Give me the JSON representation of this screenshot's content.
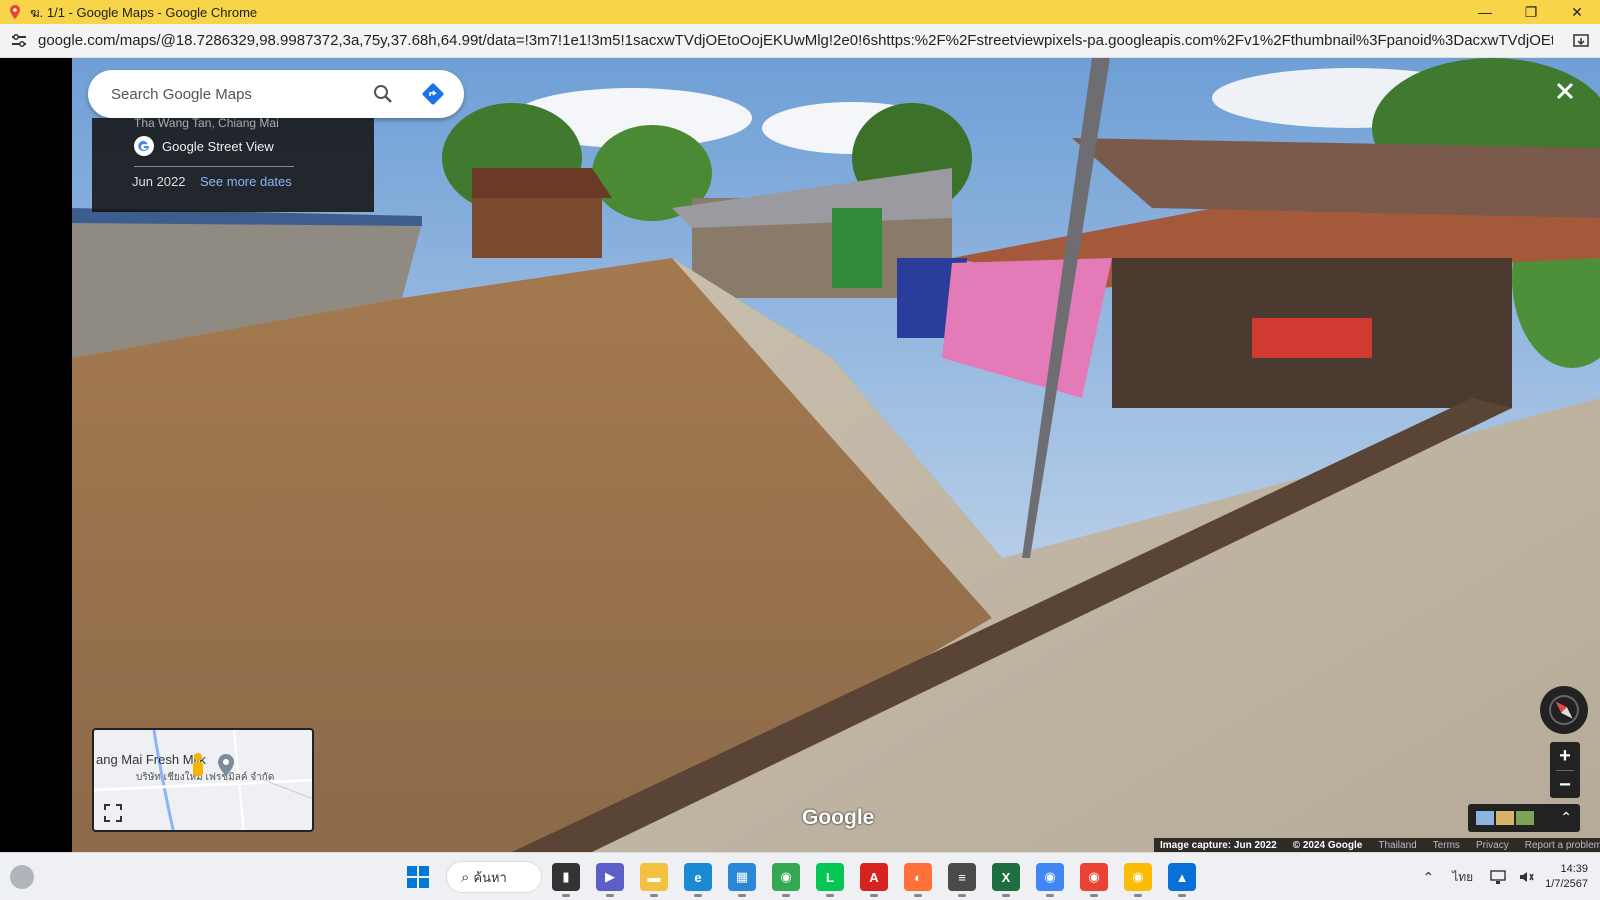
{
  "window": {
    "title": "ฆ. 1/1 - Google Maps - Google Chrome",
    "minimize": "—",
    "restore": "❐",
    "close": "✕"
  },
  "address_bar": {
    "url": "google.com/maps/@18.7286329,98.9987372,3a,75y,37.68h,64.99t/data=!3m7!1e1!3m5!1sacxwTVdjOEtoOojEKUwMlg!2e0!6shttps:%2F%2Fstreetviewpixels-pa.googleapis.com%2Fv1%2Fthumbnail%3Fpanoid%3DacxwTVdjOEtoOojEKUwMlg%26cb_..."
  },
  "maps": {
    "search_placeholder": "Search Google Maps",
    "info_subtitle": "Tha Wang Tan, Chiang Mai",
    "source_label": "Google Street View",
    "capture_date": "Jun 2022",
    "see_more_dates": "See more dates",
    "close_label": "✕",
    "watermark": "Google",
    "minimap": {
      "place_name": "ang Mai Fresh Milk",
      "place_thai": "บริษัท เชียงใหม่ เฟรชมิลค์ จำกัด"
    },
    "zoom_in": "+",
    "zoom_out": "−",
    "layers_chevron": "⌃",
    "attribution": {
      "capture": "Image capture: Jun 2022",
      "copyright": "© 2024 Google",
      "country": "Thailand",
      "terms": "Terms",
      "privacy": "Privacy",
      "report": "Report a problem"
    }
  },
  "taskbar": {
    "search_label": "ค้นหา",
    "tray_language": "ไทย",
    "time": "14:39",
    "date": "1/7/2567",
    "apps": [
      {
        "name": "file-explorer",
        "color": "#333333",
        "glyph": "▮"
      },
      {
        "name": "teams",
        "color": "#5b5fc7",
        "glyph": "▶"
      },
      {
        "name": "folder",
        "color": "#f3c03f",
        "glyph": "▬"
      },
      {
        "name": "edge",
        "color": "#1a8ad4",
        "glyph": "e"
      },
      {
        "name": "store",
        "color": "#2b88d8",
        "glyph": "▦"
      },
      {
        "name": "chrome",
        "color": "#34a853",
        "glyph": "◉"
      },
      {
        "name": "line",
        "color": "#06c755",
        "glyph": "L"
      },
      {
        "name": "acrobat",
        "color": "#d7231f",
        "glyph": "A"
      },
      {
        "name": "firefox",
        "color": "#ff7139",
        "glyph": "◐"
      },
      {
        "name": "sublime",
        "color": "#4a4a4a",
        "glyph": "≡"
      },
      {
        "name": "excel",
        "color": "#1d6f42",
        "glyph": "X"
      },
      {
        "name": "chrome-profile-2",
        "color": "#4285f4",
        "glyph": "◉"
      },
      {
        "name": "chrome-profile-3",
        "color": "#ea4335",
        "glyph": "◉"
      },
      {
        "name": "chrome-active",
        "color": "#fbbc05",
        "glyph": "◉"
      },
      {
        "name": "photos",
        "color": "#0a6fd8",
        "glyph": "▲"
      }
    ]
  }
}
